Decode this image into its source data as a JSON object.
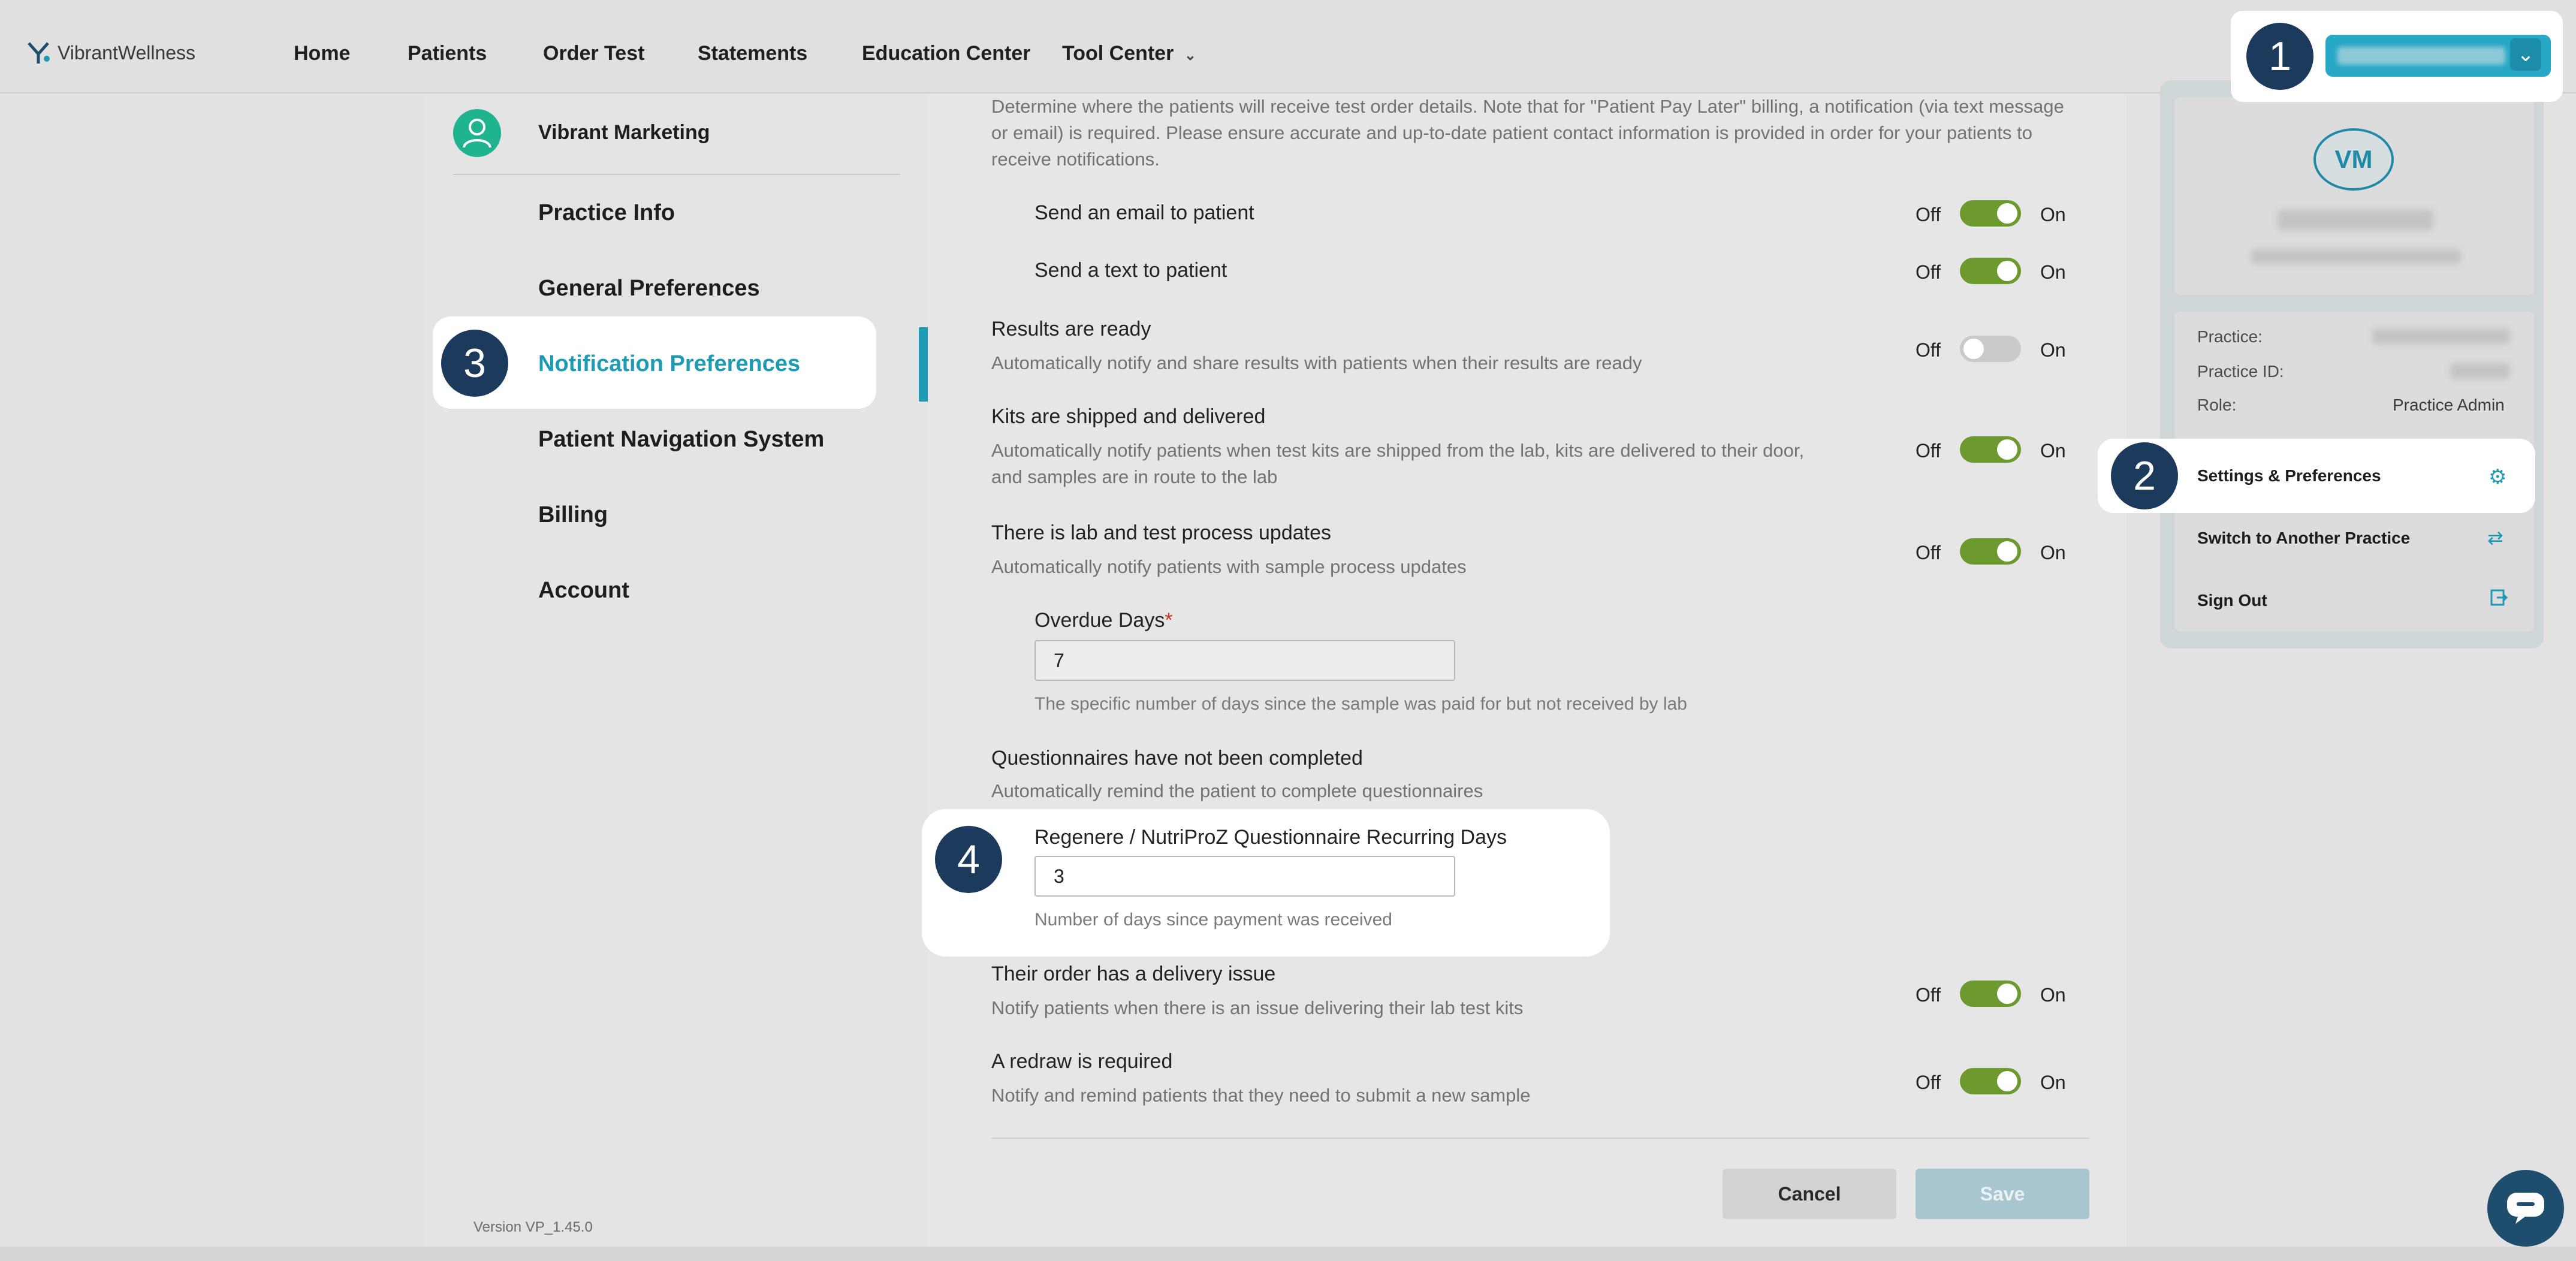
{
  "header": {
    "logo_text": "VibrantWellness",
    "nav": [
      {
        "label": "Home"
      },
      {
        "label": "Patients"
      },
      {
        "label": "Order Test"
      },
      {
        "label": "Statements"
      },
      {
        "label": "Education Center"
      },
      {
        "label": "Tool Center"
      }
    ]
  },
  "sidebar": {
    "account_name": "Vibrant Marketing",
    "items": [
      {
        "label": "Practice Info"
      },
      {
        "label": "General Preferences"
      },
      {
        "label": "Notification Preferences",
        "active": true
      },
      {
        "label": "Patient Navigation System"
      },
      {
        "label": "Billing"
      },
      {
        "label": "Account"
      }
    ],
    "version": "Version VP_1.45.0"
  },
  "main": {
    "intro": "Determine where the patients will receive test order details. Note that for \"Patient Pay Later\" billing, a notification (via text message or email) is required. Please ensure accurate and up-to-date patient contact information is provided in order for your patients to receive notifications.",
    "off_label": "Off",
    "on_label": "On",
    "settings": {
      "email": {
        "title": "Send an email to patient",
        "enabled": true
      },
      "text": {
        "title": "Send a text to patient",
        "enabled": true
      },
      "results": {
        "title": "Results are ready",
        "desc": "Automatically notify and share results with patients when their results are ready",
        "enabled": false
      },
      "kits": {
        "title": "Kits are shipped and delivered",
        "desc": "Automatically notify patients when test kits are shipped from the lab, kits are delivered to their door, and samples are in route to the lab",
        "enabled": true
      },
      "lab": {
        "title": "There is lab and test process updates",
        "desc": "Automatically notify patients with sample process updates",
        "enabled": true
      },
      "delivery": {
        "title": "Their order has a delivery issue",
        "desc": "Notify patients when there is an issue delivering their lab test kits",
        "enabled": true
      },
      "redraw": {
        "title": "A redraw is required",
        "desc": "Notify and remind patients that they need to submit a new sample",
        "enabled": true
      }
    },
    "overdue": {
      "label": "Overdue Days",
      "required_mark": "*",
      "value": "7",
      "hint": "The specific number of days since the sample was paid for but not received by lab"
    },
    "questionnaire": {
      "title": "Questionnaires have not been completed",
      "desc": "Automatically remind the patient to complete questionnaires"
    },
    "recurring": {
      "label": "Regenere / NutriProZ Questionnaire Recurring Days",
      "value": "3",
      "hint": "Number of days since payment was received"
    },
    "cancel_label": "Cancel",
    "save_label": "Save"
  },
  "account_menu": {
    "initials": "VM",
    "practice_label": "Practice:",
    "practice_id_label": "Practice ID:",
    "role_label": "Role:",
    "role_value": "Practice Admin",
    "items": [
      {
        "label": "Settings & Preferences",
        "icon": "gear-icon"
      },
      {
        "label": "Switch to Another Practice",
        "icon": "swap-icon"
      },
      {
        "label": "Sign Out",
        "icon": "sign-out-icon"
      }
    ]
  },
  "badges": [
    "1",
    "2",
    "3",
    "4"
  ],
  "colors": {
    "accent": "#1d9bb4",
    "toggle_on": "#6d9a2e",
    "badge": "#1b3a5c"
  }
}
